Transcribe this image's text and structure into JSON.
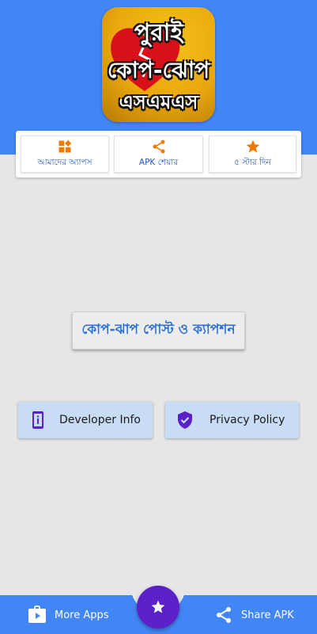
{
  "app": {
    "logo_lines": [
      "পুরাই",
      "কোপ-ঝোপ",
      "এসএমএস"
    ]
  },
  "top_menu": {
    "items": [
      {
        "label": "আমাদের অ্যাপস",
        "icon": "apps-grid-icon",
        "color": "#f07a00"
      },
      {
        "label": "APK শেয়ার",
        "icon": "share-icon",
        "color": "#f07a00"
      },
      {
        "label": "৫ স্টার দিন",
        "icon": "star-icon",
        "color": "#f07a00"
      }
    ]
  },
  "main": {
    "primary_button": "কোপ-ঝাপ পোস্ট ও ক্যাপশন",
    "developer_info": "Developer Info",
    "privacy_policy": "Privacy Policy"
  },
  "bottom_nav": {
    "more_apps": "More Apps",
    "share_apk": "Share APK",
    "fab_icon": "star-icon"
  },
  "colors": {
    "header": "#4285f4",
    "background": "#e6e6e6",
    "accent_orange": "#f07a00",
    "fab": "#5c20c8",
    "info_button": "#c8dcf6",
    "icon_purple": "#5c20c8"
  }
}
